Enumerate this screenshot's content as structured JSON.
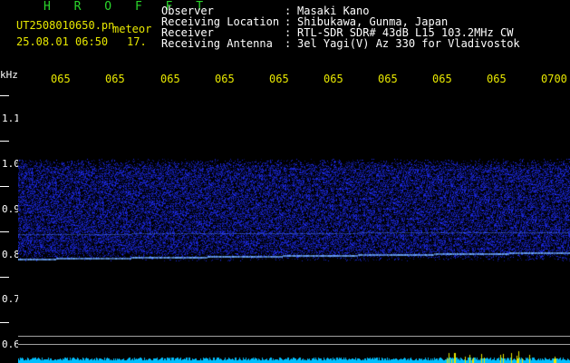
{
  "header": {
    "title": "H R O F F T",
    "filename": "UT2508010650.pn",
    "type": "meteor",
    "datetime": "25.08.01 06:50",
    "count": "17.",
    "fields": [
      {
        "label": "Observer",
        "value": "Masaki Kano"
      },
      {
        "label": "Receiving Location",
        "value": "Shibukawa, Gunma, Japan"
      },
      {
        "label": "Receiver",
        "value": "RTL-SDR SDR# 43dB L15 103.2MHz CW"
      },
      {
        "label": "Receiving Antenna",
        "value": "3el Yagi(V) Az 330 for Vladivostok"
      }
    ]
  },
  "axis": {
    "unit": "kHz",
    "y_ticks": [
      "1.1",
      "1.0",
      "0.9",
      "0.8",
      "0.7",
      "0.6"
    ],
    "x_ticks": [
      "065",
      "065",
      "065",
      "065",
      "065",
      "065",
      "065",
      "065",
      "065",
      "0700"
    ]
  },
  "colors": {
    "background": "#000000",
    "signal": "#2f3cff",
    "carrier": "#7fb8ff",
    "noise_floor": "#00bfff",
    "burst": "#e8e800"
  }
}
